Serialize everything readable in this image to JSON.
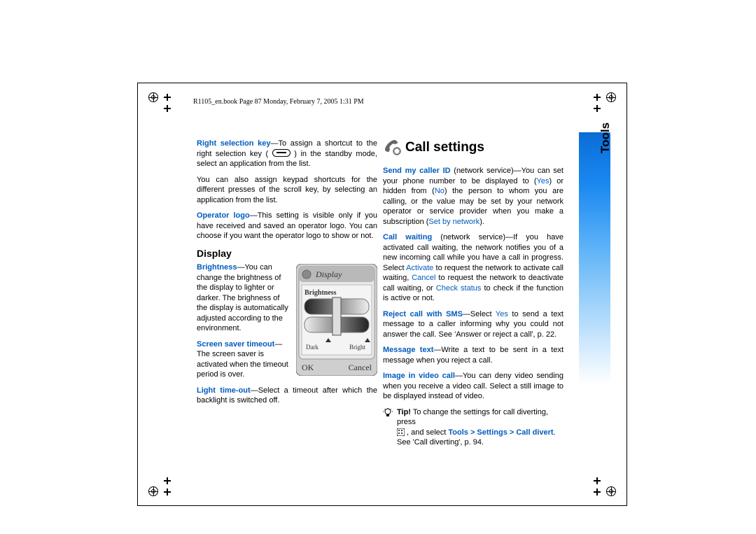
{
  "header": "R1105_en.book  Page 87  Monday, February 7, 2005  1:31 PM",
  "side": {
    "section": "Tools",
    "page": "87"
  },
  "left": {
    "p1": {
      "term": "Right selection key",
      "rest": "—To assign a shortcut to the right selection key ( ) in the standby mode, select an application from the list."
    },
    "p2": "You can also assign keypad shortcuts for the different presses of the scroll key, by selecting an application from the list.",
    "p3": {
      "term": "Operator logo",
      "rest": "—This setting is visible only if you have received and saved an operator logo. You can choose if you want the operator logo to show or not."
    },
    "h": "Display",
    "p4": {
      "term": "Brightness",
      "rest": "—You can change the brightness of the display to lighter or darker. The brighness of the display is automatically adjusted according to the environment."
    },
    "p5": {
      "term": "Screen saver timeout",
      "rest": "—The screen saver is activated when the timeout period is over."
    },
    "p6": {
      "term": "Light time-out",
      "rest": "—Select a timeout after which the backlight is switched off."
    }
  },
  "right_title": "Call settings",
  "right": {
    "p1": {
      "term": "Send my caller ID",
      "a": " (network service)—You can set your phone number to be displayed to (",
      "yes": "Yes",
      "b": ") or hidden from (",
      "no": "No",
      "c": ") the person to whom you are calling, or the value may be set by your network operator or service provider when you make a subscription (",
      "net": "Set by network",
      "d": ")."
    },
    "p2": {
      "term": "Call waiting",
      "a": " (network service)—If you have activated call waiting, the network notifies you of a new incoming call while you have a call in progress. Select ",
      "act": "Activate",
      "b": " to request the network to activate call waiting, ",
      "can": "Cancel",
      "c": " to request the network to deactivate call waiting, or ",
      "chk": "Check status",
      "d": " to check if the function is active or not."
    },
    "p3": {
      "term": "Reject call with SMS",
      "a": "—Select ",
      "yes": "Yes",
      "b": " to send a text message to a caller informing why you could not answer the call. See 'Answer or reject a call', p. 22."
    },
    "p4": {
      "term": "Message text",
      "rest": "—Write a text to be sent in a text message when you reject a call."
    },
    "p5": {
      "term": "Image in video call",
      "rest": "—You can deny video sending when you receive a video call. Select a still image to be displayed instead of video."
    },
    "tip": {
      "lead": "Tip!",
      "a": " To change the settings for call diverting, press ",
      "b": " , and select ",
      "path": "Tools > Settings > Call divert",
      "c": ". See 'Call diverting', p. 94."
    }
  },
  "shot": {
    "title": "Display",
    "word": "Brightness",
    "dark": "Dark",
    "bright": "Bright",
    "ok": "OK",
    "cancel": "Cancel"
  }
}
